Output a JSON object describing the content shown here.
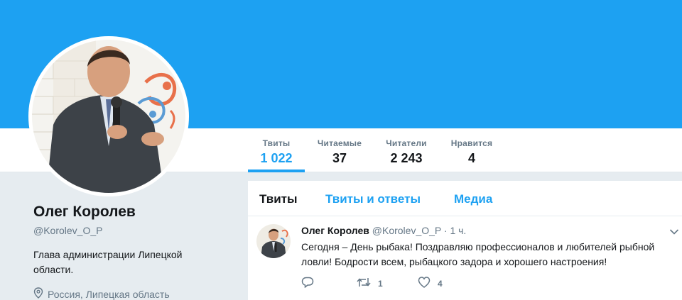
{
  "profile": {
    "name": "Олег Королев",
    "handle": "@Korolev_O_P",
    "bio": "Глава администрации Липецкой области.",
    "location": "Россия, Липецкая область"
  },
  "stats": [
    {
      "label": "Твиты",
      "value": "1 022"
    },
    {
      "label": "Читаемые",
      "value": "37"
    },
    {
      "label": "Читатели",
      "value": "2 243"
    },
    {
      "label": "Нравится",
      "value": "4"
    }
  ],
  "tabs": [
    "Твиты",
    "Твиты и ответы",
    "Медиа"
  ],
  "tweet": {
    "name": "Олег Королев",
    "handle": "@Korolev_O_P",
    "time": "· 1 ч.",
    "text": "Сегодня – День рыбака! Поздравляю профессионалов и любителей рыбной ловли! Бодрости всем, рыбацкого задора и хорошего настроения!",
    "retweets": "1",
    "likes": "4"
  },
  "colors": {
    "accent": "#1da1f2",
    "banner": "#1da1f2",
    "muted": "#657786",
    "background": "#e6ecf0"
  }
}
